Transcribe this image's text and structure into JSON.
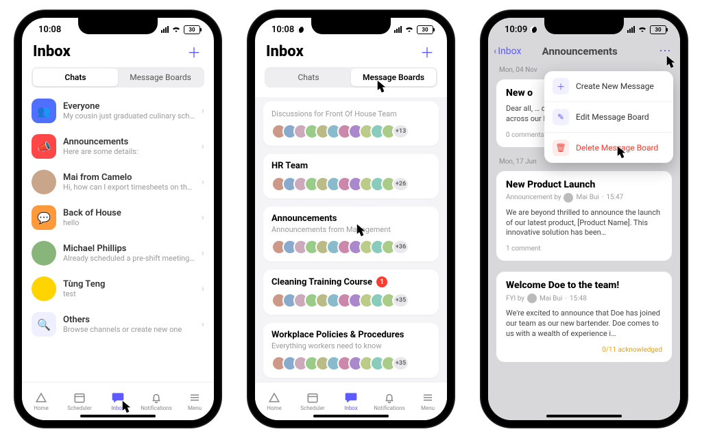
{
  "status": {
    "time1": "10:08",
    "time2": "10:08",
    "time3": "10:09",
    "battery": "30"
  },
  "inbox": {
    "title": "Inbox",
    "seg_chats": "Chats",
    "seg_boards": "Message Boards",
    "items": [
      {
        "title": "Everyone",
        "sub": "My cousin just graduated culinary schoo…",
        "avatar_bg": "#4f6fff",
        "avatar_glyph": "👥",
        "shape": "rounded"
      },
      {
        "title": "Announcements",
        "sub": "Here are some details:",
        "avatar_bg": "#ff4747",
        "avatar_glyph": "📣",
        "shape": "rounded"
      },
      {
        "title": "Mai from Camelo",
        "sub": "Hi, how can I export timesheets on the …",
        "avatar_bg": "#c9a58a",
        "avatar_glyph": "",
        "shape": "circle"
      },
      {
        "title": "Back of House",
        "sub": "hello",
        "avatar_bg": "#ff9a3c",
        "avatar_glyph": "💬",
        "shape": "rounded"
      },
      {
        "title": "Michael Phillips",
        "sub": "Already scheduled a pre-shift meeting f…",
        "avatar_bg": "#87b57a",
        "avatar_glyph": "",
        "shape": "circle"
      },
      {
        "title": "Tùng Teng",
        "sub": "test",
        "avatar_bg": "#ffd400",
        "avatar_glyph": "",
        "shape": "circle"
      },
      {
        "title": "Others",
        "sub": "Browse channels or create new one",
        "avatar_bg": "#eef0ff",
        "avatar_glyph": "🔍",
        "shape": "rounded"
      }
    ]
  },
  "boards": {
    "title": "Inbox",
    "top_card": {
      "sub": "Discussions for Front Of House Team",
      "more": "+13"
    },
    "cards": [
      {
        "title": "HR Team",
        "sub": "",
        "more": "+26",
        "badge": ""
      },
      {
        "title": "Announcements",
        "sub": "Announcements from Management",
        "more": "+36",
        "badge": ""
      },
      {
        "title": "Cleaning Training Course",
        "sub": "",
        "more": "+35",
        "badge": "1"
      },
      {
        "title": "Workplace Policies & Procedures",
        "sub": "Everything workers need to know",
        "more": "+35",
        "badge": ""
      }
    ]
  },
  "ann": {
    "back_label": "Inbox",
    "title": "Announcements",
    "menu": {
      "create": "Create New Message",
      "edit": "Edit Message Board",
      "delete": "Delete Message Board"
    },
    "section1_date": "Mon, 04 Nov",
    "section2_date": "Mon, 17 Jun",
    "posts": [
      {
        "title": "New o",
        "meta_author": "",
        "body": "Dear all, … development … probably came across our latest job openi…",
        "comments": "0 comments",
        "ack": "0/11 acknowledged"
      },
      {
        "title": "New Product Launch",
        "meta_prefix": "Announcement by",
        "meta_author": "Mai Bui",
        "meta_time": "15:47",
        "body": "We are beyond thrilled to announce the launch of our latest product, [Product Name]. This innovative solution has been…",
        "comments": "1 comment",
        "ack": ""
      },
      {
        "title": "Welcome Doe to the team!",
        "meta_prefix": "FYI by",
        "meta_author": "Mai Bui",
        "meta_time": "15:48",
        "body": "We're excited to announce that Doe has joined our team as our new bartender. Doe comes to us with a wealth of experience i…",
        "comments": "",
        "ack": "0/11 acknowledged"
      }
    ]
  },
  "tabs": {
    "home": "Home",
    "scheduler": "Scheduler",
    "inbox": "Inbox",
    "notifications": "Notifications",
    "menu": "Menu"
  }
}
